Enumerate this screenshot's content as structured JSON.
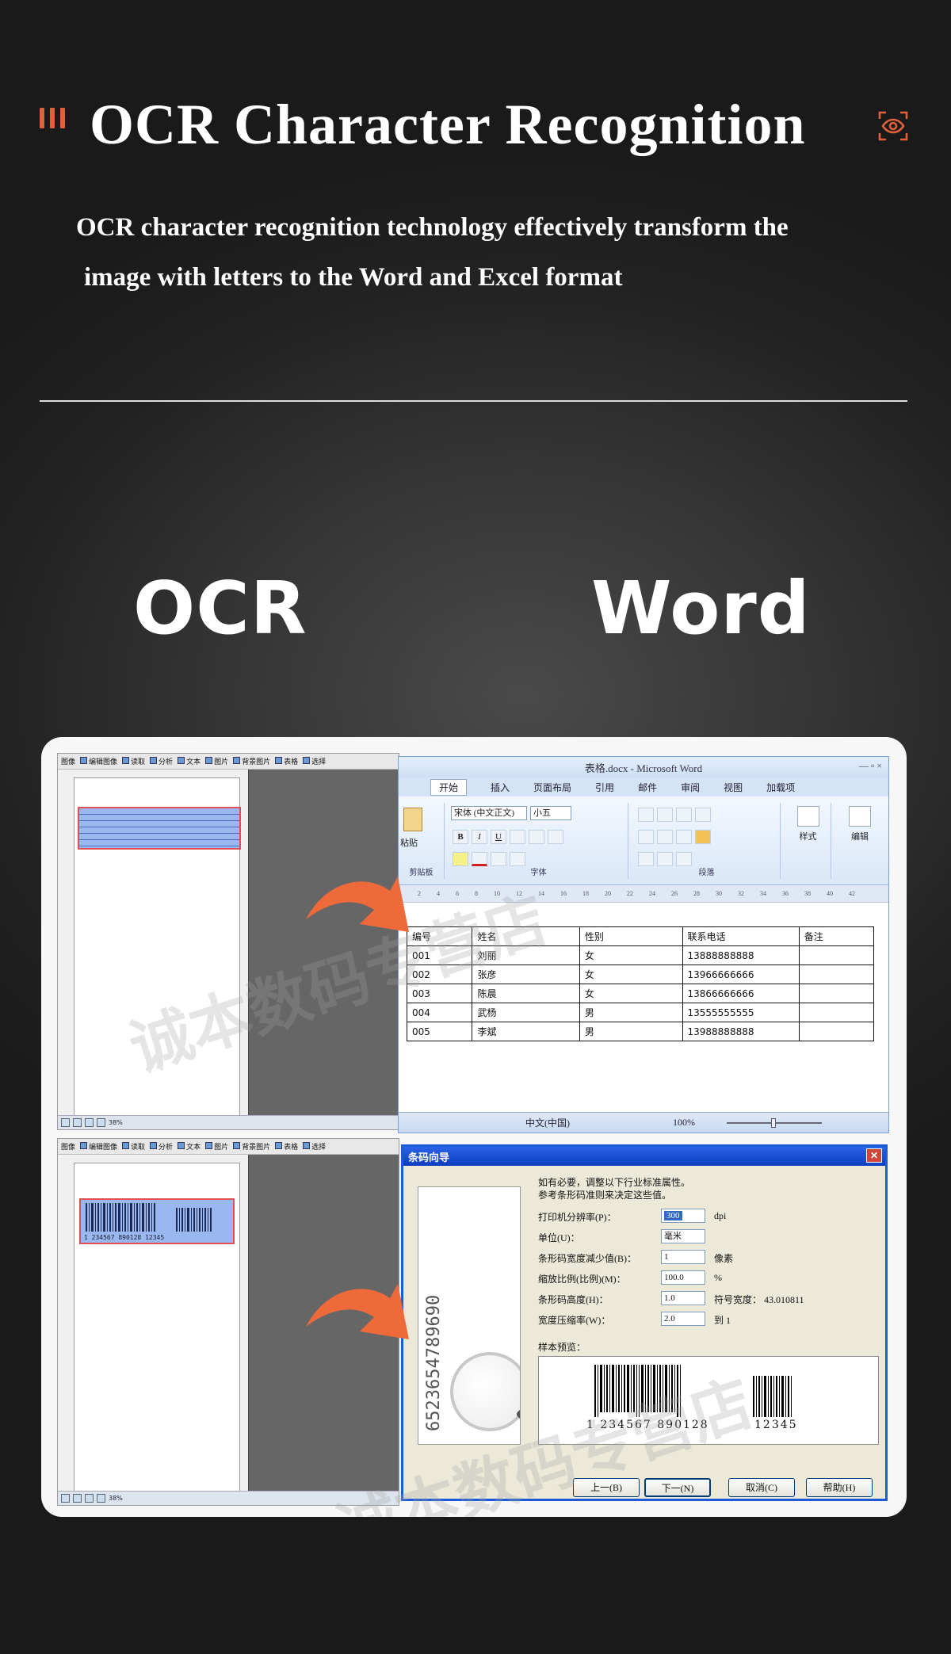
{
  "header": {
    "title": "OCR Character Recognition",
    "description_line1": "OCR character recognition technology effectively transform the",
    "description_line2": "image with letters to the Word and Excel format"
  },
  "labels": {
    "left": "OCR",
    "right": "Word"
  },
  "colors": {
    "accent": "#e2603a",
    "background": "#2b2b2b",
    "arrow": "#ef6a3a"
  },
  "icons": {
    "title_deco": "triple-bar-icon",
    "title_right": "eye-scan-icon"
  },
  "ocr_app": {
    "toolbar": [
      "图像",
      "编辑图像",
      "读取",
      "分析",
      "文本",
      "图片",
      "背景图片",
      "表格",
      "选择"
    ],
    "zoom": "38%"
  },
  "word": {
    "title": "表格.docx - Microsoft Word",
    "tabs": [
      "开始",
      "插入",
      "页面布局",
      "引用",
      "邮件",
      "审阅",
      "视图",
      "加载项"
    ],
    "font_name": "宋体 (中文正文)",
    "font_size": "小五",
    "groups": [
      "粘贴",
      "剪贴板",
      "字体",
      "段落",
      "样式",
      "编辑"
    ],
    "ruler": [
      "2",
      "4",
      "6",
      "8",
      "10",
      "12",
      "14",
      "16",
      "18",
      "20",
      "22",
      "24",
      "26",
      "28",
      "30",
      "32",
      "34",
      "36",
      "38",
      "40",
      "42"
    ],
    "table_header": [
      "编号",
      "姓名",
      "性别",
      "联系电话",
      "备注"
    ],
    "table_rows": [
      [
        "001",
        "刘丽",
        "女",
        "13888888888",
        ""
      ],
      [
        "002",
        "张彦",
        "女",
        "13966666666",
        ""
      ],
      [
        "003",
        "陈晨",
        "女",
        "13866666666",
        ""
      ],
      [
        "004",
        "武杨",
        "男",
        "13555555555",
        ""
      ],
      [
        "005",
        "李斌",
        "男",
        "13988888888",
        ""
      ]
    ],
    "status_lang": "中文(中国)",
    "status_zoom": "100%"
  },
  "barcode_dialog": {
    "title": "条码向导",
    "hint1": "如有必要，调整以下行业标准属性。",
    "hint2": "参考条形码准则来决定这些值。",
    "fields": [
      {
        "label": "打印机分辨率(P)：",
        "value": "300",
        "unit": "dpi"
      },
      {
        "label": "单位(U)：",
        "value": "毫米",
        "unit": ""
      },
      {
        "label": "条形码宽度减少值(B)：",
        "value": "1",
        "unit": "像素"
      },
      {
        "label": "缩放比例(比例)(M)：",
        "value": "100.0",
        "unit": "%"
      },
      {
        "label": "条形码高度(H)：",
        "value": "1.0",
        "unit": "符号宽度：  43.010811"
      },
      {
        "label": "宽度压缩率(W)：",
        "value": "2.0",
        "unit": "到 1"
      }
    ],
    "preview_label": "样本预览：",
    "digits": "6523654789690",
    "preview_main": "1 234567 890128",
    "preview_addon": "12345",
    "ocr_barcode_text": "1 234567 890128    12345",
    "buttons": [
      "上一(B)",
      "下一(N)",
      "取消(C)",
      "帮助(H)"
    ]
  },
  "watermark": "诚本数码专营店"
}
